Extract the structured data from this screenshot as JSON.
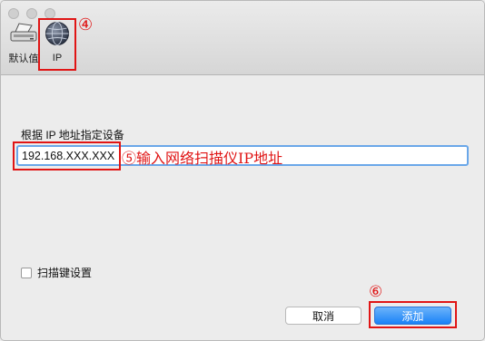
{
  "toolbar": {
    "items": [
      {
        "label": "默认值",
        "icon": "scanner-icon"
      },
      {
        "label": "IP",
        "icon": "network-globe-icon"
      }
    ]
  },
  "form": {
    "field_label": "根据 IP 地址指定设备",
    "ip_value": "192.168.XXX.XXX",
    "checkbox_label": "扫描键设置"
  },
  "buttons": {
    "cancel": "取消",
    "add": "添加"
  },
  "annotations": {
    "step4": "④",
    "step5": "⑤输入网络扫描仪IP地址",
    "step6": "⑥"
  },
  "colors": {
    "annotation": "#e01515",
    "focus_ring": "#6aa7e9",
    "primary_button": "#1a82f7"
  }
}
